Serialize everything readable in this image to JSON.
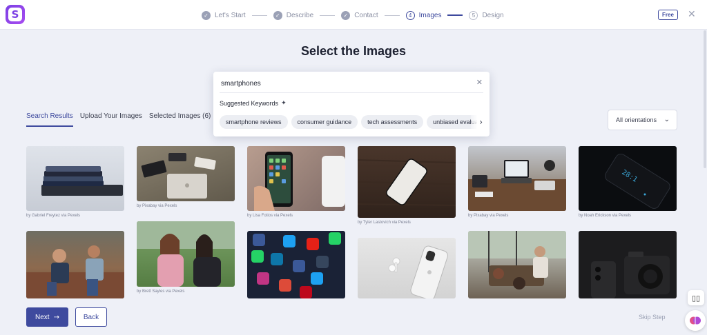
{
  "app": {
    "logo_letter": "S"
  },
  "steps": [
    {
      "label": "Let's Start",
      "state": "done",
      "marker": "✓"
    },
    {
      "label": "Describe",
      "state": "done",
      "marker": "✓"
    },
    {
      "label": "Contact",
      "state": "done",
      "marker": "✓"
    },
    {
      "label": "Images",
      "state": "active",
      "marker": "4"
    },
    {
      "label": "Design",
      "state": "todo",
      "marker": "5"
    }
  ],
  "header": {
    "plan_badge": "Free",
    "close_icon": "close-icon"
  },
  "page": {
    "title": "Select the Images"
  },
  "search": {
    "value": "smartphones",
    "suggested_title": "Suggested Keywords",
    "keywords": [
      "smartphone reviews",
      "consumer guidance",
      "tech assessments",
      "unbiased evaluations"
    ]
  },
  "tabs": [
    {
      "label": "Search Results",
      "active": true
    },
    {
      "label": "Upload Your Images",
      "active": false
    },
    {
      "label": "Selected Images (6)",
      "active": false
    }
  ],
  "filter": {
    "orientation": "All orientations"
  },
  "images": [
    {
      "credit": "by Gabriel Freytez via Pexels"
    },
    {
      "credit": "by Pixabay via Pexels"
    },
    {
      "credit": "by Lisa Fotios via Pexels"
    },
    {
      "credit": "by Tyler Lastovich via Pexels"
    },
    {
      "credit": "by Pixabay via Pexels"
    },
    {
      "credit": "by Noah Erickson via Pexels"
    },
    {
      "credit": ""
    },
    {
      "credit": "by Brett Sayles via Pexels"
    },
    {
      "credit": ""
    },
    {
      "credit": ""
    },
    {
      "credit": ""
    },
    {
      "credit": ""
    }
  ],
  "footer": {
    "next_label": "Next",
    "back_label": "Back",
    "skip_label": "Skip Step"
  },
  "colors": {
    "accent": "#3e4a9e",
    "brand": "#7b3fe4",
    "background": "#eef0f7"
  }
}
